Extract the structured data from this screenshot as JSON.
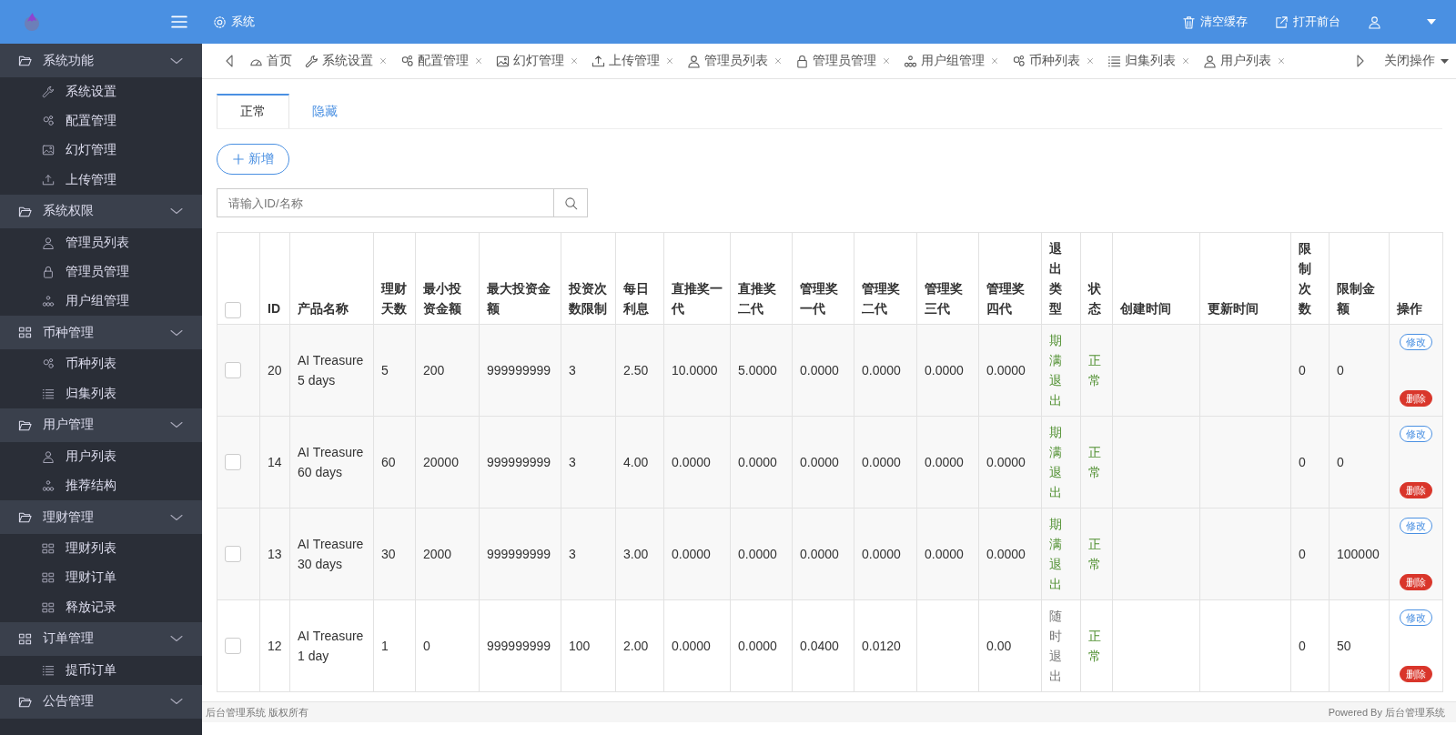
{
  "topbar": {
    "title": "系统",
    "actions": [
      {
        "label": "清空缓存",
        "kind": "trash"
      },
      {
        "label": "打开前台",
        "kind": "external-link"
      }
    ]
  },
  "sidebar": {
    "groups": [
      {
        "label": "系统功能",
        "kind": "folder",
        "children": [
          {
            "label": "系统设置",
            "kind": "wrench"
          },
          {
            "label": "配置管理",
            "kind": "gears"
          },
          {
            "label": "幻灯管理",
            "kind": "image"
          },
          {
            "label": "上传管理",
            "kind": "upload"
          }
        ]
      },
      {
        "label": "系统权限",
        "kind": "folder",
        "children": [
          {
            "label": "管理员列表",
            "kind": "user"
          },
          {
            "label": "管理员管理",
            "kind": "lock"
          },
          {
            "label": "用户组管理",
            "kind": "hierarchy"
          }
        ]
      },
      {
        "label": "币种管理",
        "kind": "grid",
        "children": [
          {
            "label": "币种列表",
            "kind": "gears"
          },
          {
            "label": "归集列表",
            "kind": "list"
          }
        ]
      },
      {
        "label": "用户管理",
        "kind": "folder",
        "children": [
          {
            "label": "用户列表",
            "kind": "user"
          },
          {
            "label": "推荐结构",
            "kind": "hierarchy"
          }
        ]
      },
      {
        "label": "理财管理",
        "kind": "folder",
        "children": [
          {
            "label": "理财列表",
            "kind": "grid"
          },
          {
            "label": "理财订单",
            "kind": "grid"
          },
          {
            "label": "释放记录",
            "kind": "grid"
          }
        ]
      },
      {
        "label": "订单管理",
        "kind": "grid",
        "children": [
          {
            "label": "提币订单",
            "kind": "list"
          }
        ]
      },
      {
        "label": "公告管理",
        "kind": "folder"
      }
    ]
  },
  "page_tabs": {
    "items": [
      {
        "label": "首页",
        "kind": "gauge",
        "closable": false,
        "selected": false
      },
      {
        "label": "系统设置",
        "kind": "wrench",
        "closable": true,
        "selected": false
      },
      {
        "label": "配置管理",
        "kind": "gears",
        "closable": true,
        "selected": false
      },
      {
        "label": "幻灯管理",
        "kind": "image",
        "closable": true,
        "selected": false
      },
      {
        "label": "上传管理",
        "kind": "upload",
        "closable": true,
        "selected": false
      },
      {
        "label": "管理员列表",
        "kind": "user",
        "closable": true,
        "selected": false
      },
      {
        "label": "管理员管理",
        "kind": "lock",
        "closable": true,
        "selected": false
      },
      {
        "label": "用户组管理",
        "kind": "hierarchy",
        "closable": true,
        "selected": false
      },
      {
        "label": "币种列表",
        "kind": "gears",
        "closable": true,
        "selected": false
      },
      {
        "label": "归集列表",
        "kind": "list",
        "closable": true,
        "selected": false
      },
      {
        "label": "用户列表",
        "kind": "user",
        "closable": true,
        "selected": false
      }
    ],
    "close_menu": "关闭操作"
  },
  "content_tabs": [
    {
      "label": "正常",
      "selected": true
    },
    {
      "label": "隐藏",
      "selected": false
    }
  ],
  "add_button": "新增",
  "search": {
    "placeholder": "请输入ID/名称"
  },
  "table": {
    "all_checked": false,
    "columns": [
      "ID",
      "产品名称",
      "理财天数",
      "最小投资金额",
      "最大投资金额",
      "投资次数限制",
      "每日利息",
      "直推奖一代",
      "直推奖二代",
      "管理奖一代",
      "管理奖二代",
      "管理奖三代",
      "管理奖四代",
      "退出类型",
      "状态",
      "创建时间",
      "更新时间",
      "限制次数",
      "限制金额",
      "操作"
    ],
    "rows": [
      {
        "checked": false,
        "values": {
          "id": "20",
          "name": "AI Treasure 5 days",
          "days": "5",
          "min": "200",
          "max": "999999999",
          "times": "3",
          "rate": "2.50",
          "direct_1": "10.0000",
          "direct_2": "5.0000",
          "mgmt_1": "0.0000",
          "mgmt_2": "0.0000",
          "mgmt_3": "0.0000",
          "mgmt_4": "0.0000"
        },
        "exit_type": {
          "text": "期满退出",
          "kind": "expiry"
        },
        "status": "正常",
        "limit_count": "0",
        "limit_amount": "0",
        "actions": [
          {
            "label": "修改",
            "kind": "edit"
          },
          {
            "label": "删除",
            "kind": "delete"
          }
        ]
      },
      {
        "checked": false,
        "values": {
          "id": "14",
          "name": "AI Treasure 60 days",
          "days": "60",
          "min": "20000",
          "max": "999999999",
          "times": "3",
          "rate": "4.00",
          "direct_1": "0.0000",
          "direct_2": "0.0000",
          "mgmt_1": "0.0000",
          "mgmt_2": "0.0000",
          "mgmt_3": "0.0000",
          "mgmt_4": "0.0000"
        },
        "exit_type": {
          "text": "期满退出",
          "kind": "expiry"
        },
        "status": "正常",
        "limit_count": "0",
        "limit_amount": "0",
        "actions": [
          {
            "label": "修改",
            "kind": "edit"
          },
          {
            "label": "删除",
            "kind": "delete"
          }
        ]
      },
      {
        "checked": false,
        "values": {
          "id": "13",
          "name": "AI Treasure 30 days",
          "days": "30",
          "min": "2000",
          "max": "999999999",
          "times": "3",
          "rate": "3.00",
          "direct_1": "0.0000",
          "direct_2": "0.0000",
          "mgmt_1": "0.0000",
          "mgmt_2": "0.0000",
          "mgmt_3": "0.0000",
          "mgmt_4": "0.0000"
        },
        "exit_type": {
          "text": "期满退出",
          "kind": "expiry"
        },
        "status": "正常",
        "limit_count": "0",
        "limit_amount": "100000",
        "actions": [
          {
            "label": "修改",
            "kind": "edit"
          },
          {
            "label": "删除",
            "kind": "delete"
          }
        ]
      },
      {
        "checked": false,
        "values": {
          "id": "12",
          "name": "AI Treasure 1 day",
          "days": "1",
          "min": "0",
          "max": "999999999",
          "times": "100",
          "rate": "2.00",
          "direct_1": "0.0000",
          "direct_2": "0.0000",
          "mgmt_1": "0.0400",
          "mgmt_2": "0.0120",
          "mgmt_4": "0.00"
        },
        "exit_type": {
          "text": "随时退出",
          "kind": "anytime"
        },
        "status": "正常",
        "limit_count": "0",
        "limit_amount": "50",
        "actions": [
          {
            "label": "修改",
            "kind": "edit"
          },
          {
            "label": "删除",
            "kind": "delete"
          }
        ]
      }
    ]
  },
  "footer": {
    "left": "后台管理系统 版权所有",
    "right": "Powered By 后台管理系统"
  }
}
